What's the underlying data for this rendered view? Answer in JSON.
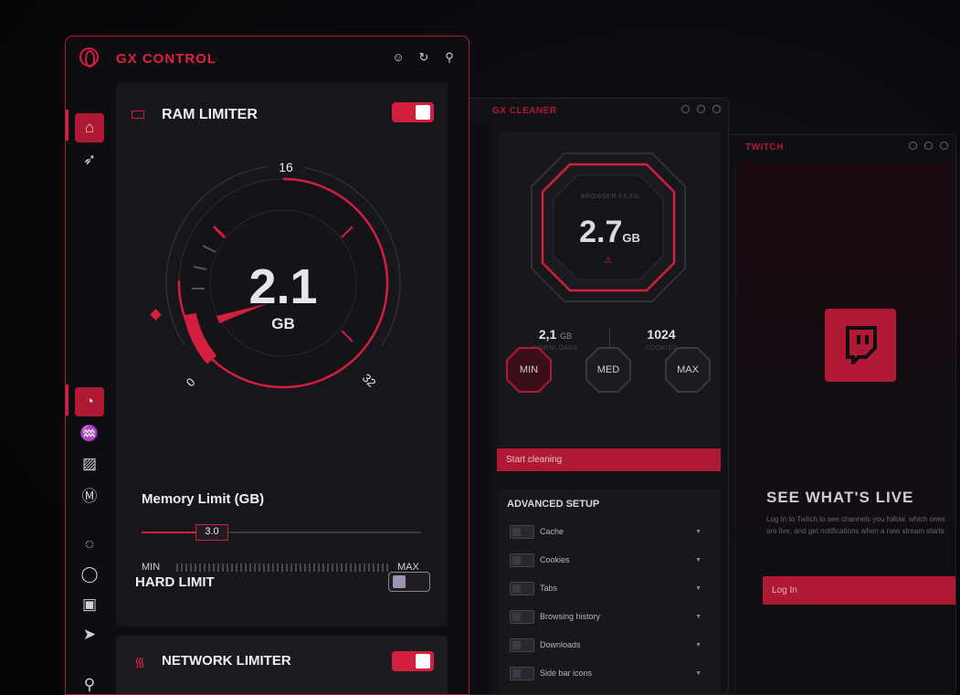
{
  "colors": {
    "accent": "#d41e3e",
    "accent_dark": "#b01934",
    "panel": "#17161c"
  },
  "twitch": {
    "title": "TWITCH",
    "headline": "SEE WHAT'S LIVE",
    "description": "Log In to Twitch to see channels you follow, which ones are live, and get notifications when a new stream starts",
    "login": "Log In"
  },
  "cleaner": {
    "title": "GX CLEANER",
    "files_label": "BROWSER FILES",
    "size_value": "2.7",
    "size_unit": "GB",
    "downloads_value": "2,1",
    "downloads_unit": "GB",
    "downloads_label": "DOWNLOADS",
    "cookies_value": "1024",
    "cookies_label": "COOKIES",
    "modes": [
      "MIN",
      "MED",
      "MAX"
    ],
    "start": "Start cleaning",
    "advanced_title": "ADVANCED SETUP",
    "options": [
      "Cache",
      "Cookies",
      "Tabs",
      "Browsing history",
      "Downloads",
      "Side bar icons"
    ]
  },
  "gx": {
    "title": "GX CONTROL",
    "ram": {
      "title": "RAM LIMITER",
      "value": "2.1",
      "unit": "GB",
      "max_label": "16",
      "min_tick": "0",
      "max_tick": "32",
      "memory_label": "Memory Limit (GB)",
      "slider_value": "3.0",
      "min": "MIN",
      "max": "MAX",
      "hard_limit": "HARD LIMIT"
    },
    "network": {
      "title": "NETWORK LIMITER"
    }
  }
}
